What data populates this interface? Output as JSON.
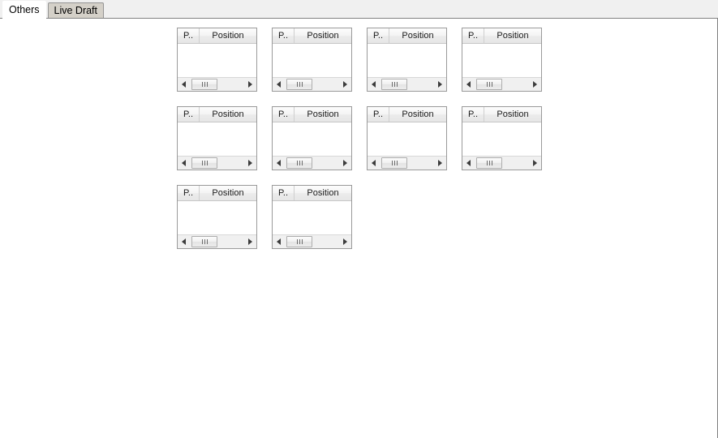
{
  "window": {
    "background": "#ffffff",
    "border_color": "#808080"
  },
  "tabbar": {
    "background": "#f0f0f0",
    "tabs": [
      {
        "label": "Others",
        "selected": true
      },
      {
        "label": "Live Draft",
        "selected": false
      }
    ]
  },
  "panel_template": {
    "columns": [
      {
        "key": "p",
        "label": "P.."
      },
      {
        "key": "position",
        "label": "Position"
      }
    ],
    "rows": [],
    "scrollbar": {
      "left_arrow_icon": "triangle-left-icon",
      "right_arrow_icon": "triangle-right-icon",
      "thumb_grip_icon": "grip-lines-icon",
      "thumb_position_percent": 3
    }
  },
  "grid": {
    "rows": [
      {
        "panels": [
          {
            "columns": [
              {
                "label": "P.."
              },
              {
                "label": "Position"
              }
            ]
          },
          {
            "columns": [
              {
                "label": "P.."
              },
              {
                "label": "Position"
              }
            ]
          },
          {
            "columns": [
              {
                "label": "P.."
              },
              {
                "label": "Position"
              }
            ]
          },
          {
            "columns": [
              {
                "label": "P.."
              },
              {
                "label": "Position"
              }
            ]
          }
        ]
      },
      {
        "panels": [
          {
            "columns": [
              {
                "label": "P.."
              },
              {
                "label": "Position"
              }
            ]
          },
          {
            "columns": [
              {
                "label": "P.."
              },
              {
                "label": "Position"
              }
            ]
          },
          {
            "columns": [
              {
                "label": "P.."
              },
              {
                "label": "Position"
              }
            ]
          },
          {
            "columns": [
              {
                "label": "P.."
              },
              {
                "label": "Position"
              }
            ]
          }
        ]
      },
      {
        "panels": [
          {
            "columns": [
              {
                "label": "P.."
              },
              {
                "label": "Position"
              }
            ]
          },
          {
            "columns": [
              {
                "label": "P.."
              },
              {
                "label": "Position"
              }
            ]
          }
        ]
      }
    ]
  }
}
